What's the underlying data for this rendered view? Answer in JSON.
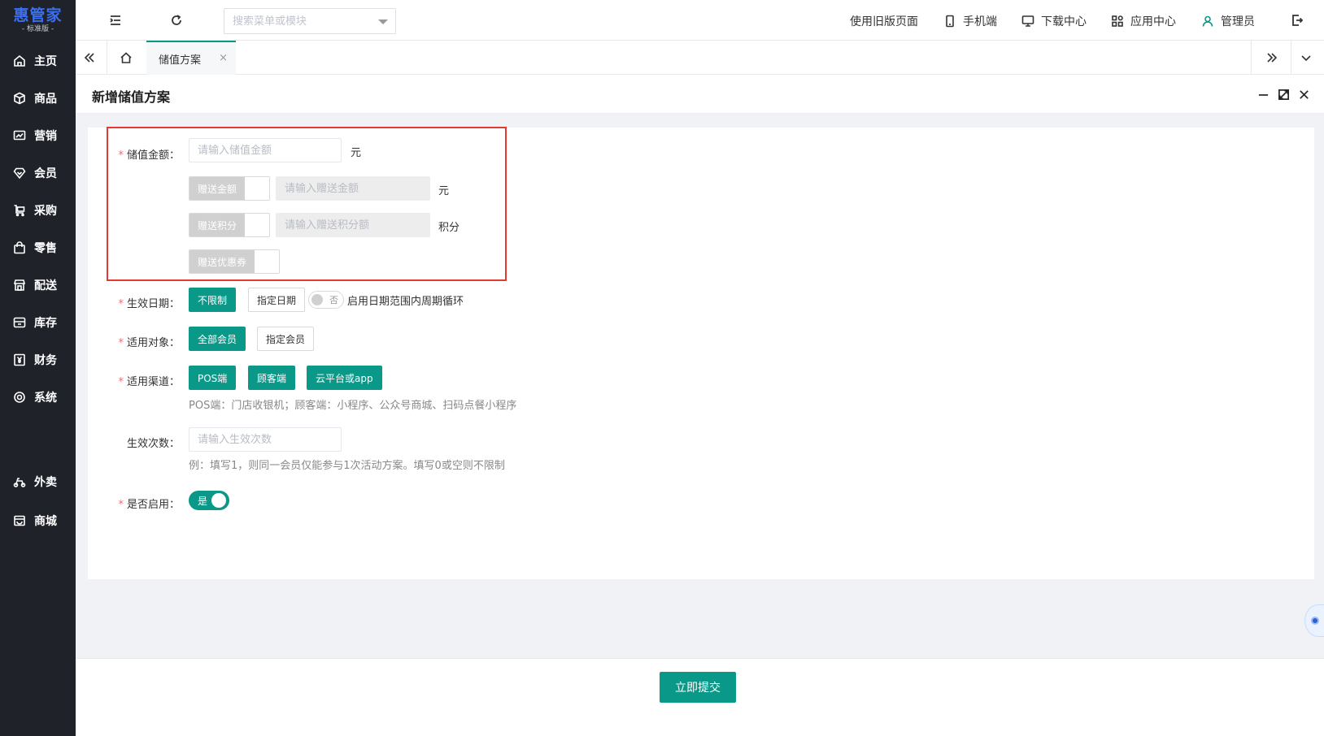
{
  "brand": {
    "name": "惠管家",
    "edition": "- 标准版 -"
  },
  "sidebar": {
    "items": [
      {
        "label": "主页",
        "icon": "home-icon"
      },
      {
        "label": "商品",
        "icon": "box-icon"
      },
      {
        "label": "营销",
        "icon": "trend-icon"
      },
      {
        "label": "会员",
        "icon": "diamond-icon"
      },
      {
        "label": "采购",
        "icon": "cart-icon"
      },
      {
        "label": "零售",
        "icon": "bag-icon"
      },
      {
        "label": "配送",
        "icon": "store-icon"
      },
      {
        "label": "库存",
        "icon": "inventory-icon"
      },
      {
        "label": "财务",
        "icon": "yen-icon"
      },
      {
        "label": "系统",
        "icon": "settings-icon"
      },
      {
        "label": "外卖",
        "icon": "scooter-icon"
      },
      {
        "label": "商城",
        "icon": "shop-icon"
      }
    ]
  },
  "topbar": {
    "search_placeholder": "搜索菜单或模块",
    "links": {
      "old_version": "使用旧版页面",
      "mobile": "手机端",
      "download": "下载中心",
      "apps": "应用中心",
      "admin": "管理员"
    }
  },
  "tabs": {
    "active": "储值方案",
    "close": "×"
  },
  "page": {
    "title": "新增储值方案"
  },
  "form": {
    "amount": {
      "label": "储值金额：",
      "placeholder": "请输入储值金额",
      "unit": "元",
      "gift_amount": {
        "switch_label": "赠送金额",
        "placeholder": "请输入赠送金额",
        "unit": "元"
      },
      "gift_points": {
        "switch_label": "赠送积分",
        "placeholder": "请输入赠送积分额",
        "unit": "积分"
      },
      "gift_coupon": {
        "switch_label": "赠送优惠券"
      }
    },
    "effective_date": {
      "label": "生效日期：",
      "option_unlimited": "不限制",
      "option_specified": "指定日期",
      "cycle_toggle_text": "否",
      "cycle_label": "启用日期范围内周期循环"
    },
    "target": {
      "label": "适用对象：",
      "option_all": "全部会员",
      "option_specified": "指定会员"
    },
    "channel": {
      "label": "适用渠道：",
      "options": [
        "POS端",
        "顾客端",
        "云平台或app"
      ],
      "hint": "POS端：门店收银机；顾客端：小程序、公众号商城、扫码点餐小程序"
    },
    "times": {
      "label": "生效次数：",
      "placeholder": "请输入生效次数",
      "hint": "例：填写1，则同一会员仅能参与1次活动方案。填写0或空则不限制"
    },
    "enabled": {
      "label": "是否启用：",
      "toggle_text": "是"
    },
    "required_mark": "*"
  },
  "footer": {
    "submit_label": "立即提交"
  },
  "colors": {
    "primary": "#0a9888",
    "sidebar_bg": "#1f2229",
    "highlight": "#e53935",
    "brand": "#3a6ff2"
  }
}
